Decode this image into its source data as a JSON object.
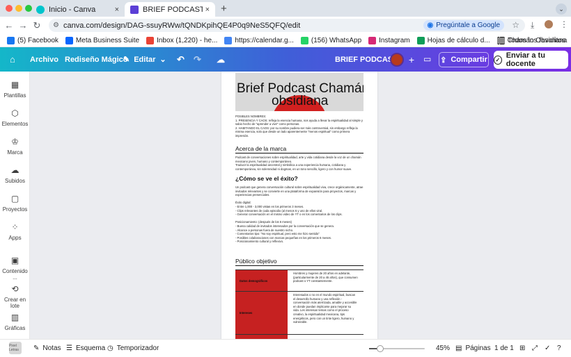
{
  "browser": {
    "tabs": [
      {
        "title": "Inicio - Canva",
        "close": "×",
        "active": false
      },
      {
        "title": "BRIEF PODCAST - Doc (digital)",
        "close": "×",
        "active": true
      }
    ],
    "new_tab": "+",
    "url": "canva.com/design/DAG-ssuyRWw/tQNDKpihQE4P0q9NeS5QFQ/edit",
    "google_button": "Pregúntale a Google",
    "bookmarks": [
      {
        "label": "(5) Facebook",
        "color": "#1877f2"
      },
      {
        "label": "Meta Business Suite",
        "color": "#0866ff"
      },
      {
        "label": "Inbox (1,220) - he...",
        "color": "#ea4335"
      },
      {
        "label": "https://calendar.g...",
        "color": "#4285f4"
      },
      {
        "label": "(156) WhatsApp",
        "color": "#25d366"
      },
      {
        "label": "Instagram",
        "color": "#d62976"
      },
      {
        "label": "Hojas de cálculo d...",
        "color": "#0f9d58"
      },
      {
        "label": "Chamán Obsidiana",
        "color": "#111111"
      }
    ],
    "all_favorites": "Todos los favoritos"
  },
  "toolbar": {
    "archivo": "Archivo",
    "rediseno": "Rediseño Mágico",
    "editar": "Editar",
    "doc_title": "BRIEF PODCAST",
    "compartir": "Compartir",
    "enviar": "Enviar a tu docente"
  },
  "sidebar": [
    {
      "label": "Plantillas",
      "icon": "templates-icon"
    },
    {
      "label": "Elementos",
      "icon": "elements-icon"
    },
    {
      "label": "Marca",
      "icon": "brand-icon"
    },
    {
      "label": "Subidos",
      "icon": "uploads-icon"
    },
    {
      "label": "Proyectos",
      "icon": "projects-icon"
    },
    {
      "label": "Apps",
      "icon": "apps-icon"
    },
    {
      "label": "Contenido ...",
      "icon": "content-icon"
    },
    {
      "label": "Crear en lote",
      "icon": "batch-icon"
    },
    {
      "label": "Gráficas",
      "icon": "charts-icon"
    }
  ],
  "doc": {
    "title_line1": "Brief Podcast Chamán",
    "title_line2": "obsidiana",
    "names_block": "POSIBLES NOMBRES:\n1. PRESENCIA Y CAOS: refleja la esencia humana, nos ayuda a llevar la espiritualidad al simple y sabio hecho de \"aprender a vivir\" como personas.\n2. HABITANDO EL CAOS: por su nombre pudiera ser más controversial, sin embargo refleja la misma esencia, solo que desde un lado aparentemente \"menos espiritual\" como primera impresión.",
    "about_heading": "Acerca de la marca",
    "about_text": "Podcast de conversaciones sobre espiritualidad, arte y vida cotidiana desde la voz de un chamán mexicano joven, humano y contemporáneo.\nTraducir la espiritualidad ancestral y simbólica a una experiencia humana, cotidiana y contemporánea, sin solemnidad ni dogmas, en un tono sencillo, ligero y con humor suave.",
    "success_heading": "¿Cómo se ve el éxito?",
    "success_text": "Un podcast que genera conversación cultural sobre espiritualidad viva, crece orgánicamente, atrae invitados relevantes y se convierte en una plataforma de expansión para proyectos, marcas y experiencias presenciales.\n\nÉxito digital:\n- Entre 1,000 - 3,000 vistas en los primeros 3 meses.\n- Clips relevantes de cada episodio (al menos 6 y uno de ellos viral.\n- Generar conversación en el mismo video de YT o en los comentarios de los clips.\n\nPosicionamiento: (después de los 6 meses)\n- Buena calidad de invitados interesados por la conversación que se genera.\n- Alcance a personas fuera de nuestro nicho.\n- Comentarios tipo: \"No soy espiritual, pero esto me hizo sentido\"\n- Posibles colaboraciones con marcas pequeñas en los primeros 6 meses.\n- Posicionamiento cultural y reflexivo.",
    "audience_heading": "Público objetivo",
    "audience_rows": [
      {
        "label": "Datos demográficos",
        "value": "Hombres y mujeres de 20 años en adelante, (particularmente de 20 a 45 años), que consumen podcast o YT constantemente."
      },
      {
        "label": "Intereses",
        "value": "Interesados o no en el mundo espiritual, buscan el desarrollo humano y una reflexión - conversación más aterrizada, amable y accesible en donde puedan implicarse para mejorar su vida. Les interesan temas como el proceso creativo, la espiritualidad mexicana, tips energéticos, pero con un tinte ligero, humano y vulnerable."
      },
      {
        "label": "",
        "value": ""
      }
    ]
  },
  "bottom": {
    "notas": "Notas",
    "esquema": "Esquema",
    "temporizador": "Temporizador",
    "zoom": "45%",
    "zoom_fraction": 0.2,
    "paginas": "Páginas",
    "page_count": "1 de 1",
    "logo_text": "Pixel Letras"
  }
}
